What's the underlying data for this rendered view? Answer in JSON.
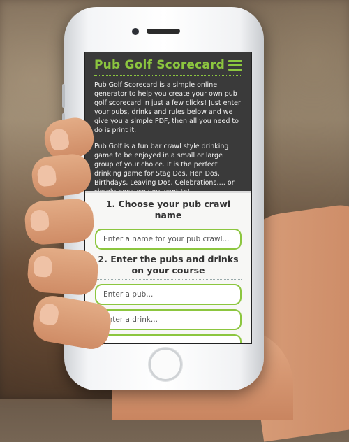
{
  "app": {
    "title": "Pub Golf Scorecard",
    "accent_color": "#8cc63f",
    "header_bg": "#3a3a3a"
  },
  "intro": {
    "p1": "Pub Golf Scorecard is a simple online generator to help you create your own pub golf scorecard in just a few clicks! Just enter your pubs, drinks and rules below and we give you a simple PDF, then all you need to do is print it.",
    "p2": "Pub Golf is a fun bar crawl style drinking game to be enjoyed in a small or large group of your choice. It is the perfect drinking game for Stag Dos, Hen Dos, Birthdays, Leaving Dos, Celebrations…. or simply because you want to!"
  },
  "step1": {
    "title": "1. Choose your pub crawl name",
    "name_placeholder": "Enter a name for your pub crawl..."
  },
  "step2": {
    "title": "2. Enter the pubs and drinks on your course",
    "pub_placeholder": "Enter a pub...",
    "drink_placeholder": "Enter a drink..."
  },
  "icons": {
    "menu": "hamburger-menu-icon"
  }
}
